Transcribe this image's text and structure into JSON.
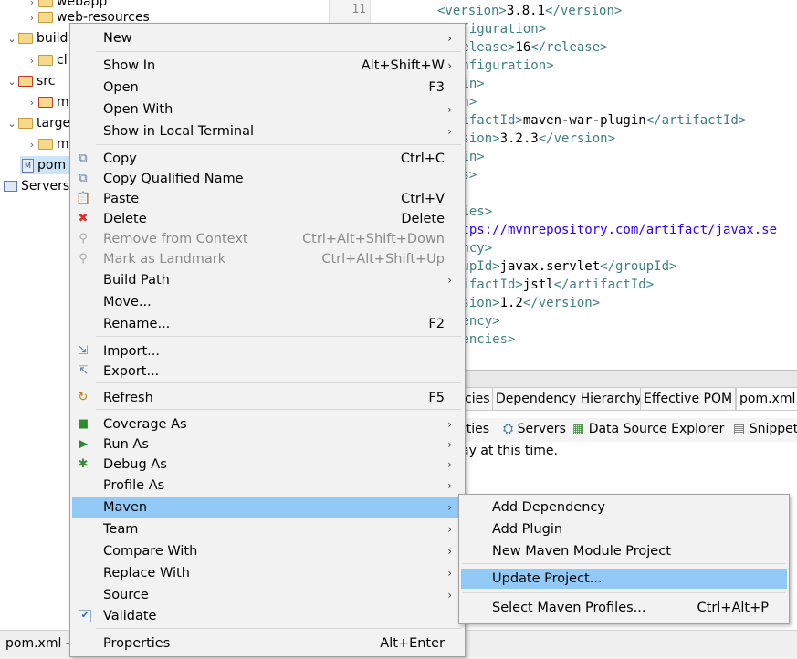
{
  "tree": {
    "items": [
      {
        "label": "webapp",
        "arrow": "›"
      },
      {
        "label": "web-resources",
        "arrow": "›"
      },
      {
        "label": "build",
        "arrow": "⌄"
      },
      {
        "label": "cl",
        "arrow": "›"
      },
      {
        "label": "src",
        "arrow": "⌄"
      },
      {
        "label": "m",
        "arrow": "›"
      },
      {
        "label": "targe",
        "arrow": "⌄"
      },
      {
        "label": "m",
        "arrow": "›"
      },
      {
        "label": "pom",
        "arrow": ""
      },
      {
        "label": "Servers",
        "arrow": ""
      }
    ]
  },
  "editor": {
    "line_number": "11",
    "lines": [
      {
        "tag1": "<version>",
        "text": "3.8.1",
        "tag2": "</version>"
      },
      {
        "tag1": "nfiguration>",
        "text": "",
        "tag2": ""
      },
      {
        "tag1": "release>",
        "text": "16",
        "tag2": "</release>"
      },
      {
        "tag1": "onfiguration>",
        "text": "",
        "tag2": ""
      },
      {
        "tag1": "gin>",
        "text": "",
        "tag2": ""
      },
      {
        "tag1": "in>",
        "text": "",
        "tag2": ""
      },
      {
        "tag1": "tifactId>",
        "text": "maven-war-plugin",
        "tag2": "</artifactId>"
      },
      {
        "tag1": "rsion>",
        "text": "3.2.3",
        "tag2": "</version>"
      },
      {
        "tag1": "gin>",
        "text": "",
        "tag2": ""
      },
      {
        "tag1": "ns>",
        "text": "",
        "tag2": ""
      },
      {
        "tag1": "",
        "text": "",
        "tag2": ""
      },
      {
        "tag1": "cies>",
        "text": "",
        "tag2": ""
      },
      {
        "tag1": "ttps://mvnrepository.com/artifact/javax.se",
        "text": "",
        "tag2": ""
      },
      {
        "tag1": "ency>",
        "text": "",
        "tag2": ""
      },
      {
        "tag1": "oupId>",
        "text": "javax.servlet",
        "tag2": "</groupId>"
      },
      {
        "tag1": "tifactId>",
        "text": "jstl",
        "tag2": "</artifactId>"
      },
      {
        "tag1": "rsion>",
        "text": "1.2",
        "tag2": "</version>"
      },
      {
        "tag1": "dency>",
        "text": "",
        "tag2": ""
      },
      {
        "tag1": "dencies>",
        "text": "",
        "tag2": ""
      }
    ]
  },
  "editor_tabs": [
    "cies",
    "Dependency Hierarchy",
    "Effective POM",
    "pom.xml"
  ],
  "view_tabs": [
    "rties",
    "Servers",
    "Data Source Explorer",
    "Snippet"
  ],
  "status_message": "ay at this time.",
  "bottom_bar": {
    "label": "pom.xml -"
  },
  "context_menu": {
    "items": [
      {
        "label": "New",
        "shortcut": "",
        "submenu": true
      },
      {
        "label": "Show In",
        "shortcut": "Alt+Shift+W",
        "submenu": true
      },
      {
        "label": "Open",
        "shortcut": "F3"
      },
      {
        "label": "Open With",
        "shortcut": "",
        "submenu": true
      },
      {
        "label": "Show in Local Terminal",
        "shortcut": "",
        "submenu": true
      },
      {
        "label": "Copy",
        "shortcut": "Ctrl+C",
        "icon": "copy-icon"
      },
      {
        "label": "Copy Qualified Name",
        "shortcut": "",
        "icon": "copy-qualified-icon"
      },
      {
        "label": "Paste",
        "shortcut": "Ctrl+V",
        "icon": "paste-icon"
      },
      {
        "label": "Delete",
        "shortcut": "Delete",
        "icon": "delete-icon"
      },
      {
        "label": "Remove from Context",
        "shortcut": "Ctrl+Alt+Shift+Down",
        "disabled": true
      },
      {
        "label": "Mark as Landmark",
        "shortcut": "Ctrl+Alt+Shift+Up",
        "disabled": true
      },
      {
        "label": "Build Path",
        "shortcut": "",
        "submenu": true
      },
      {
        "label": "Move...",
        "shortcut": ""
      },
      {
        "label": "Rename...",
        "shortcut": "F2"
      },
      {
        "label": "Import...",
        "shortcut": "",
        "icon": "import-icon"
      },
      {
        "label": "Export...",
        "shortcut": "",
        "icon": "export-icon"
      },
      {
        "label": "Refresh",
        "shortcut": "F5",
        "icon": "refresh-icon"
      },
      {
        "label": "Coverage As",
        "shortcut": "",
        "submenu": true
      },
      {
        "label": "Run As",
        "shortcut": "",
        "submenu": true
      },
      {
        "label": "Debug As",
        "shortcut": "",
        "submenu": true
      },
      {
        "label": "Profile As",
        "shortcut": "",
        "submenu": true
      },
      {
        "label": "Maven",
        "shortcut": "",
        "submenu": true,
        "highlighted": true
      },
      {
        "label": "Team",
        "shortcut": "",
        "submenu": true
      },
      {
        "label": "Compare With",
        "shortcut": "",
        "submenu": true
      },
      {
        "label": "Replace With",
        "shortcut": "",
        "submenu": true
      },
      {
        "label": "Source",
        "shortcut": "",
        "submenu": true
      },
      {
        "label": "Validate",
        "shortcut": "",
        "checked": true
      },
      {
        "label": "Properties",
        "shortcut": "Alt+Enter"
      }
    ]
  },
  "maven_submenu": {
    "items": [
      {
        "label": "Add Dependency",
        "shortcut": ""
      },
      {
        "label": "Add Plugin",
        "shortcut": ""
      },
      {
        "label": "New Maven Module Project",
        "shortcut": ""
      },
      {
        "label": "Update Project...",
        "shortcut": "",
        "highlighted": true
      },
      {
        "label": "Select Maven Profiles...",
        "shortcut": "Ctrl+Alt+P"
      }
    ]
  },
  "icons": {
    "submenu_arrow": "›",
    "check": "✔",
    "delete": "✖"
  },
  "colors": {
    "highlight": "#91c9f7",
    "menu_bg": "#f2f2f2",
    "xml_tag": "#3f7f7f",
    "url": "#2a00ff"
  }
}
